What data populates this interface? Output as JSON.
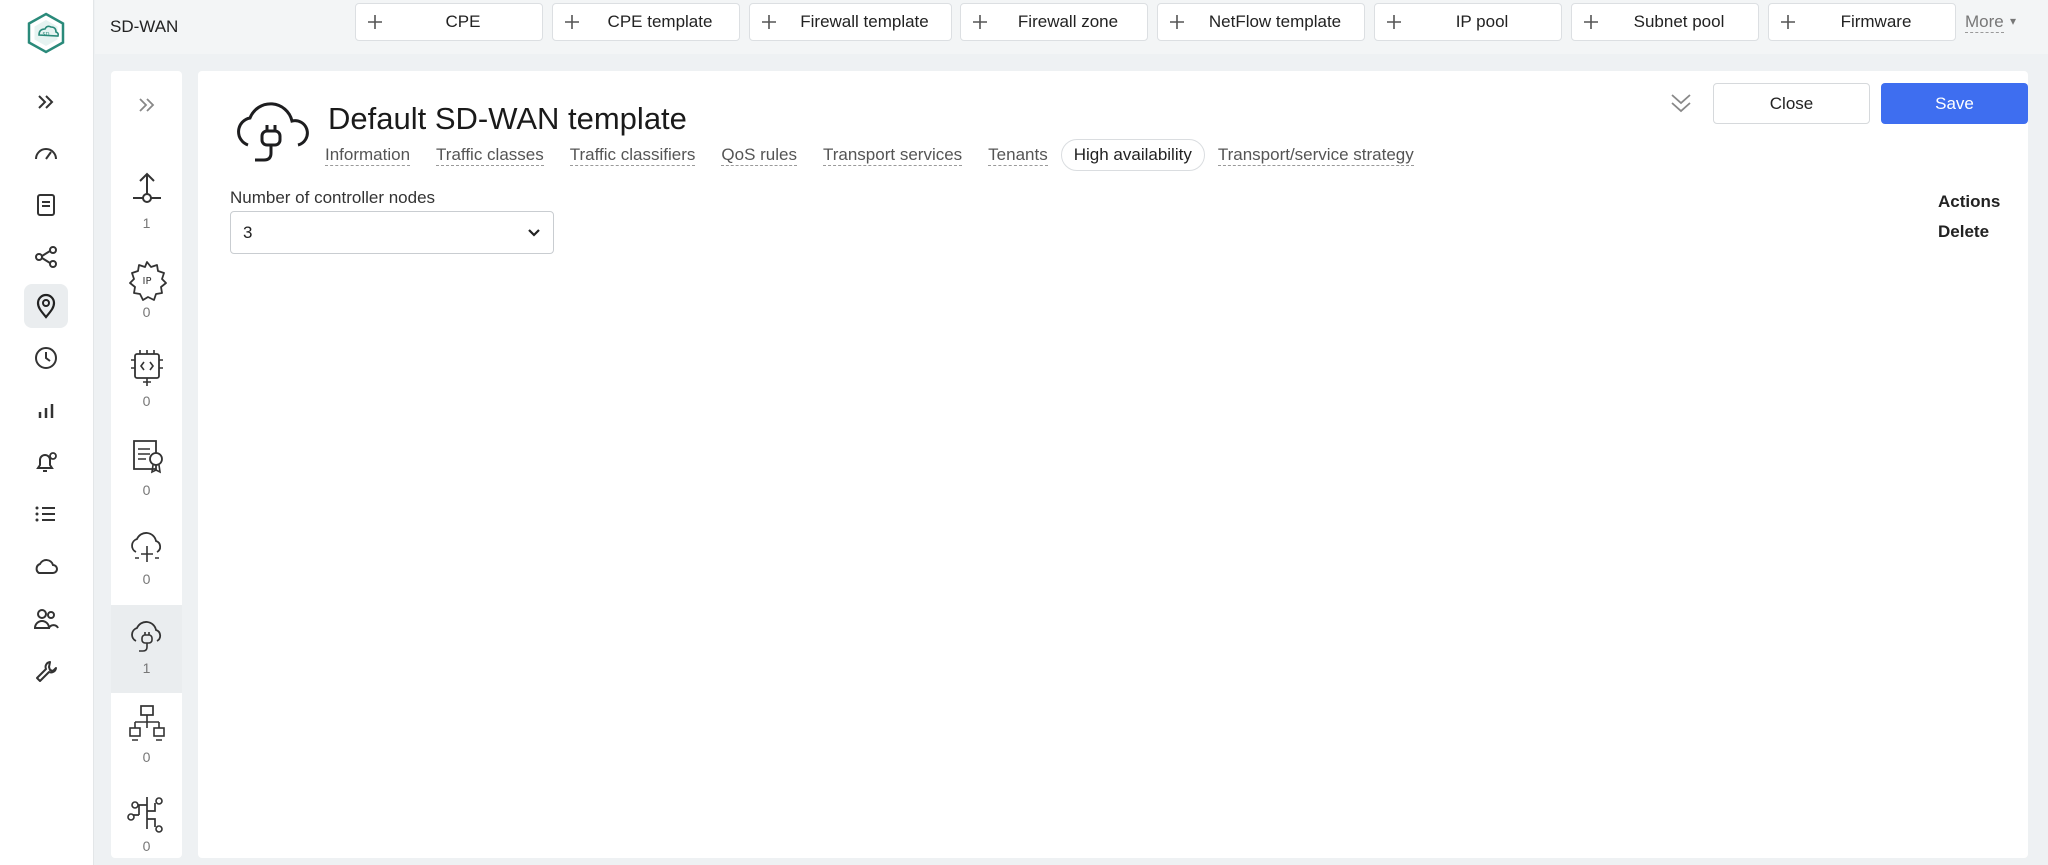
{
  "app": {
    "name": "SD-WAN"
  },
  "left_nav": {
    "icons": [
      "dashboard-icon",
      "document-icon",
      "share-icon",
      "location-icon",
      "clock-icon",
      "bar-chart-icon",
      "bell-settings-icon",
      "list-icon",
      "cloud-icon",
      "users-icon",
      "tools-icon"
    ],
    "active": "location-icon"
  },
  "quick_create": [
    {
      "label": "CPE"
    },
    {
      "label": "CPE template"
    },
    {
      "label": "Firewall template"
    },
    {
      "label": "Firewall zone"
    },
    {
      "label": "NetFlow template"
    },
    {
      "label": "IP pool"
    },
    {
      "label": "Subnet pool"
    },
    {
      "label": "Firmware"
    }
  ],
  "more_label": "More",
  "object_nav": [
    {
      "icon": "upload-node-icon",
      "count": "1"
    },
    {
      "icon": "ip-gear-icon",
      "count": "0"
    },
    {
      "icon": "chip-code-icon",
      "count": "0"
    },
    {
      "icon": "certificate-icon",
      "count": "0"
    },
    {
      "icon": "cloud-transfer-icon",
      "count": "0"
    },
    {
      "icon": "cloud-plug-icon",
      "count": "1"
    },
    {
      "icon": "network-topology-icon",
      "count": "0"
    },
    {
      "icon": "routing-icon",
      "count": "0"
    }
  ],
  "page": {
    "title": "Default SD-WAN template",
    "tabs": [
      "Information",
      "Traffic classes",
      "Traffic classifiers",
      "QoS rules",
      "Transport services",
      "Tenants",
      "High availability",
      "Transport/service strategy"
    ],
    "active_tab": "High availability",
    "field_label": "Number of controller nodes",
    "field_value": "3",
    "close_label": "Close",
    "save_label": "Save",
    "actions_title": "Actions",
    "actions_delete": "Delete"
  },
  "colors": {
    "accent": "#3e6ef0",
    "logo": "#2a8a7a"
  }
}
